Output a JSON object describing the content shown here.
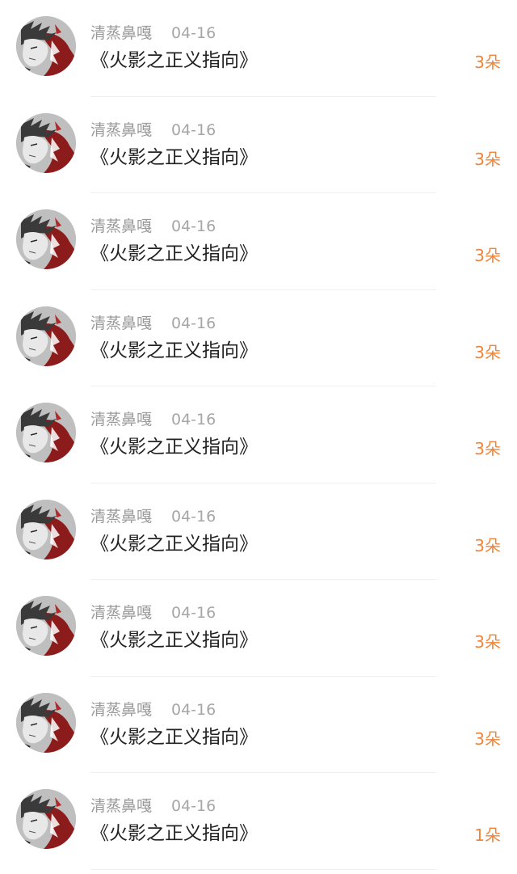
{
  "items": [
    {
      "name": "清蒸鼻嘎",
      "date": "04-16",
      "content": "《火影之正义指向》",
      "gift": "3朵"
    },
    {
      "name": "清蒸鼻嘎",
      "date": "04-16",
      "content": "《火影之正义指向》",
      "gift": "3朵"
    },
    {
      "name": "清蒸鼻嘎",
      "date": "04-16",
      "content": "《火影之正义指向》",
      "gift": "3朵"
    },
    {
      "name": "清蒸鼻嘎",
      "date": "04-16",
      "content": "《火影之正义指向》",
      "gift": "3朵"
    },
    {
      "name": "清蒸鼻嘎",
      "date": "04-16",
      "content": "《火影之正义指向》",
      "gift": "3朵"
    },
    {
      "name": "清蒸鼻嘎",
      "date": "04-16",
      "content": "《火影之正义指向》",
      "gift": "3朵"
    },
    {
      "name": "清蒸鼻嘎",
      "date": "04-16",
      "content": "《火影之正义指向》",
      "gift": "3朵"
    },
    {
      "name": "清蒸鼻嘎",
      "date": "04-16",
      "content": "《火影之正义指向》",
      "gift": "3朵"
    },
    {
      "name": "清蒸鼻嘎",
      "date": "04-16",
      "content": "《火影之正义指向》",
      "gift": "1朵"
    }
  ],
  "colors": {
    "accent": "#f0843a",
    "name_text": "#9a9a9a",
    "date_text": "#a6a6a6",
    "content_text": "#222222",
    "divider": "#efefef",
    "avatar_red": "#8c1c1c"
  },
  "icons": {
    "avatar": "anime-character-avatar"
  }
}
